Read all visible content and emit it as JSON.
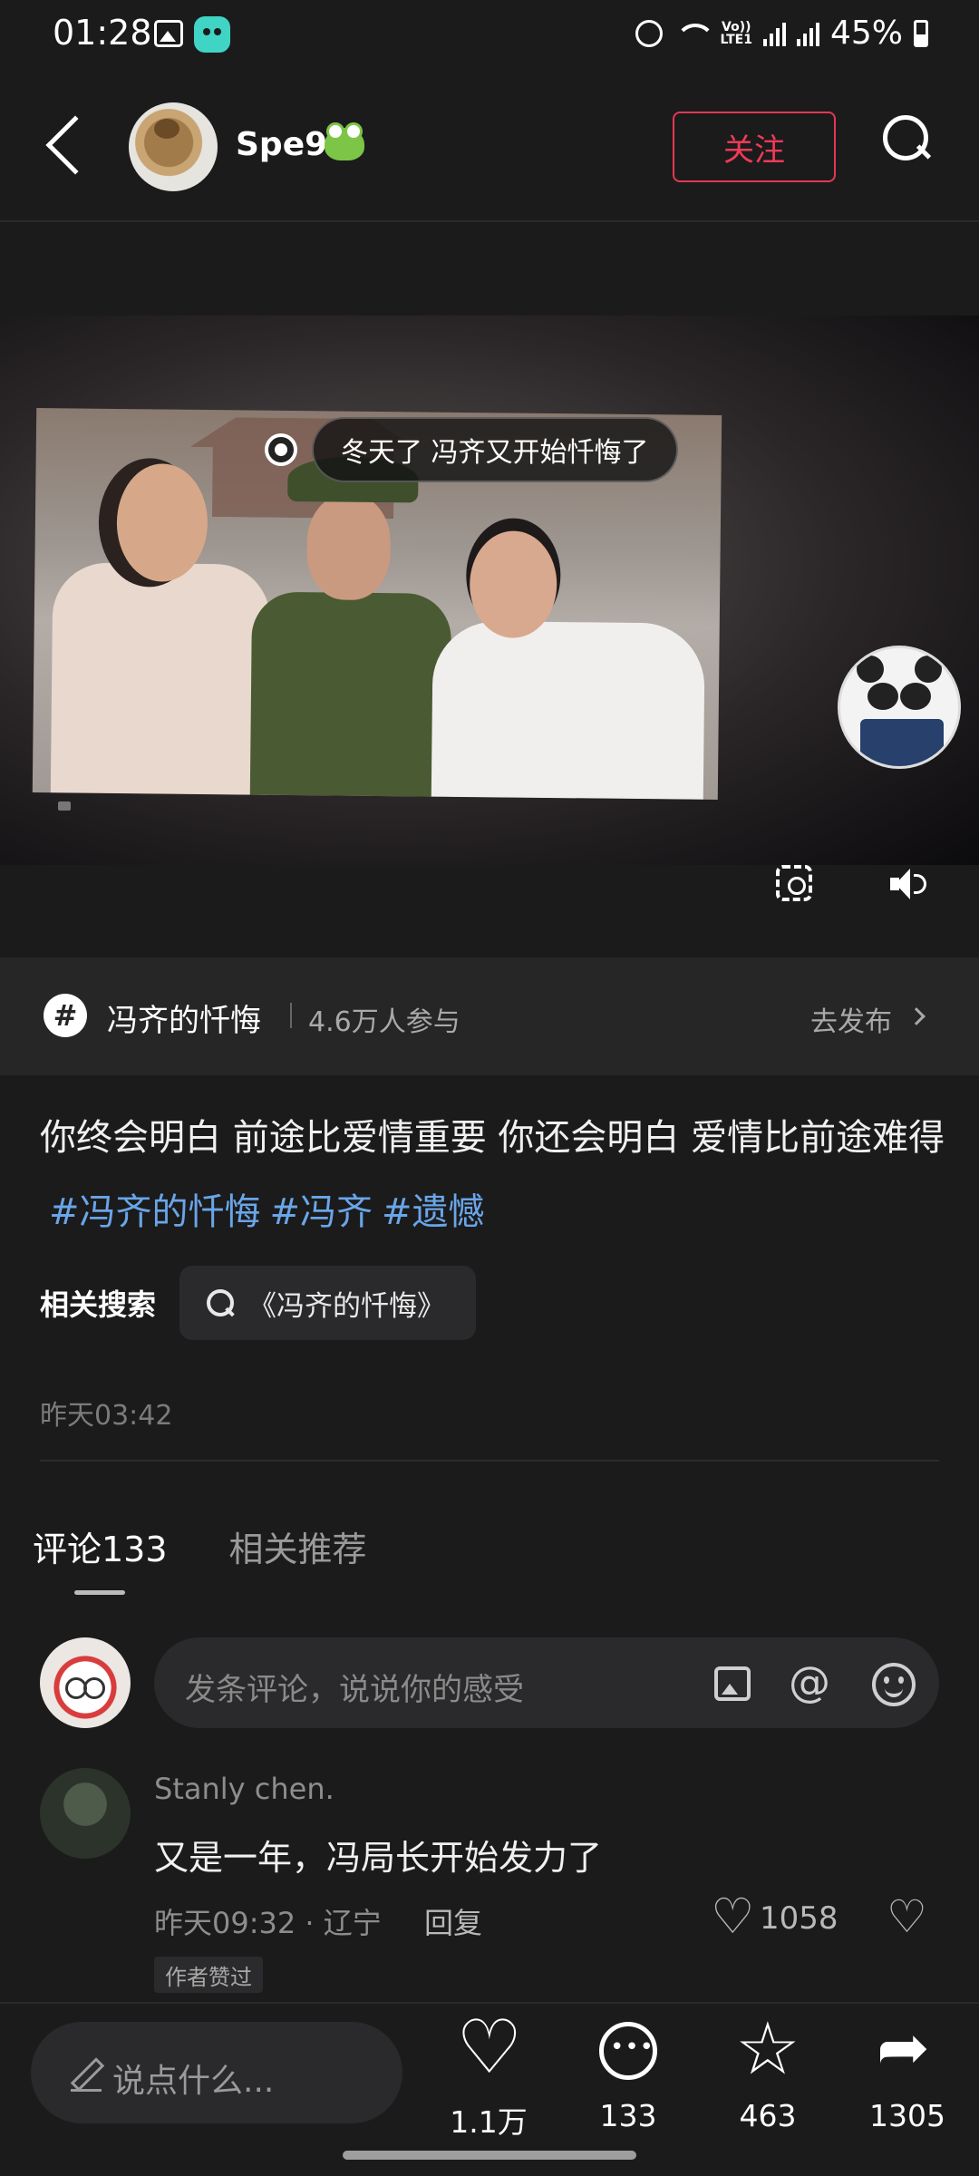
{
  "status_bar": {
    "time": "01:28",
    "lte_label": "Vo))\nLTE1",
    "battery": "45%",
    "icons": [
      "image-icon",
      "app-icon",
      "alarm-icon",
      "wifi-icon",
      "signal-icon",
      "battery-icon"
    ]
  },
  "header": {
    "username": "Spe9.",
    "follow_label": "关注"
  },
  "video": {
    "caption": "冬天了 冯齐又开始忏悔了"
  },
  "topic": {
    "hash": "#",
    "name": "冯齐的忏悔",
    "participants": "4.6万人参与",
    "publish_label": "去发布"
  },
  "post": {
    "text": "你终会明白 前途比爱情重要 你还会明白 爱情比前途难得",
    "tags": [
      "#冯齐的忏悔",
      "#冯齐",
      "#遗憾"
    ],
    "related_label": "相关搜索",
    "related_query": "《冯齐的忏悔》",
    "time": "昨天03:42"
  },
  "tabs": {
    "comments": "评论133",
    "recommend": "相关推荐"
  },
  "comment_input": {
    "placeholder": "发条评论，说说你的感受",
    "at": "@"
  },
  "comment": {
    "user": "Stanly chen.",
    "text": "又是一年，冯局长开始发力了",
    "meta": "昨天09:32 · 辽宁",
    "reply": "回复",
    "likes": "1058",
    "author_liked": "作者赞过"
  },
  "bottom_bar": {
    "say_placeholder": "说点什么...",
    "likes": "1.1万",
    "comments": "133",
    "favorites": "463",
    "shares": "1305"
  },
  "colors": {
    "background": "#1b1b1c",
    "accent_red": "#f03a58",
    "tag_blue": "#6aa5e8"
  }
}
